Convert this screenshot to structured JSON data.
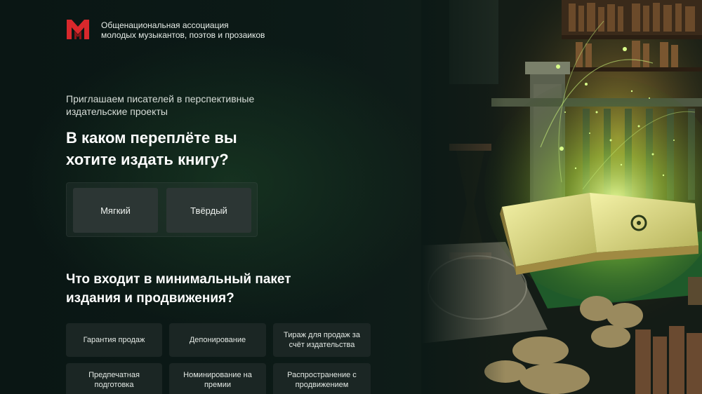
{
  "header": {
    "org_line1": "Общенациональная ассоциация",
    "org_line2": "молодых музыкантов, поэтов и прозаиков",
    "logo_icon": "mm-logo-icon",
    "brand_color": "#d8282c"
  },
  "hero": {
    "subtitle_line1": "Приглашаем писателей в перспективные",
    "subtitle_line2": "издательские проекты",
    "question_line1": "В каком переплёте вы",
    "question_line2": "хотите издать книгу?"
  },
  "binding": {
    "soft_label": "Мягкий",
    "hard_label": "Твёрдый"
  },
  "package": {
    "title_line1": "Что входит в минимальный пакет",
    "title_line2": "издания и продвижения?",
    "items": [
      {
        "line1": "Гарантия продаж",
        "line2": ""
      },
      {
        "line1": "Депонирование",
        "line2": ""
      },
      {
        "line1": "Тираж для продаж за",
        "line2": "счёт издательства"
      },
      {
        "line1": "Предпечатная",
        "line2": "подготовка"
      },
      {
        "line1": "Номинирование на",
        "line2": "премии"
      },
      {
        "line1": "Распространение с",
        "line2": "продвижением"
      }
    ]
  },
  "scene": {
    "image_subject": "magic-book-library-image"
  }
}
